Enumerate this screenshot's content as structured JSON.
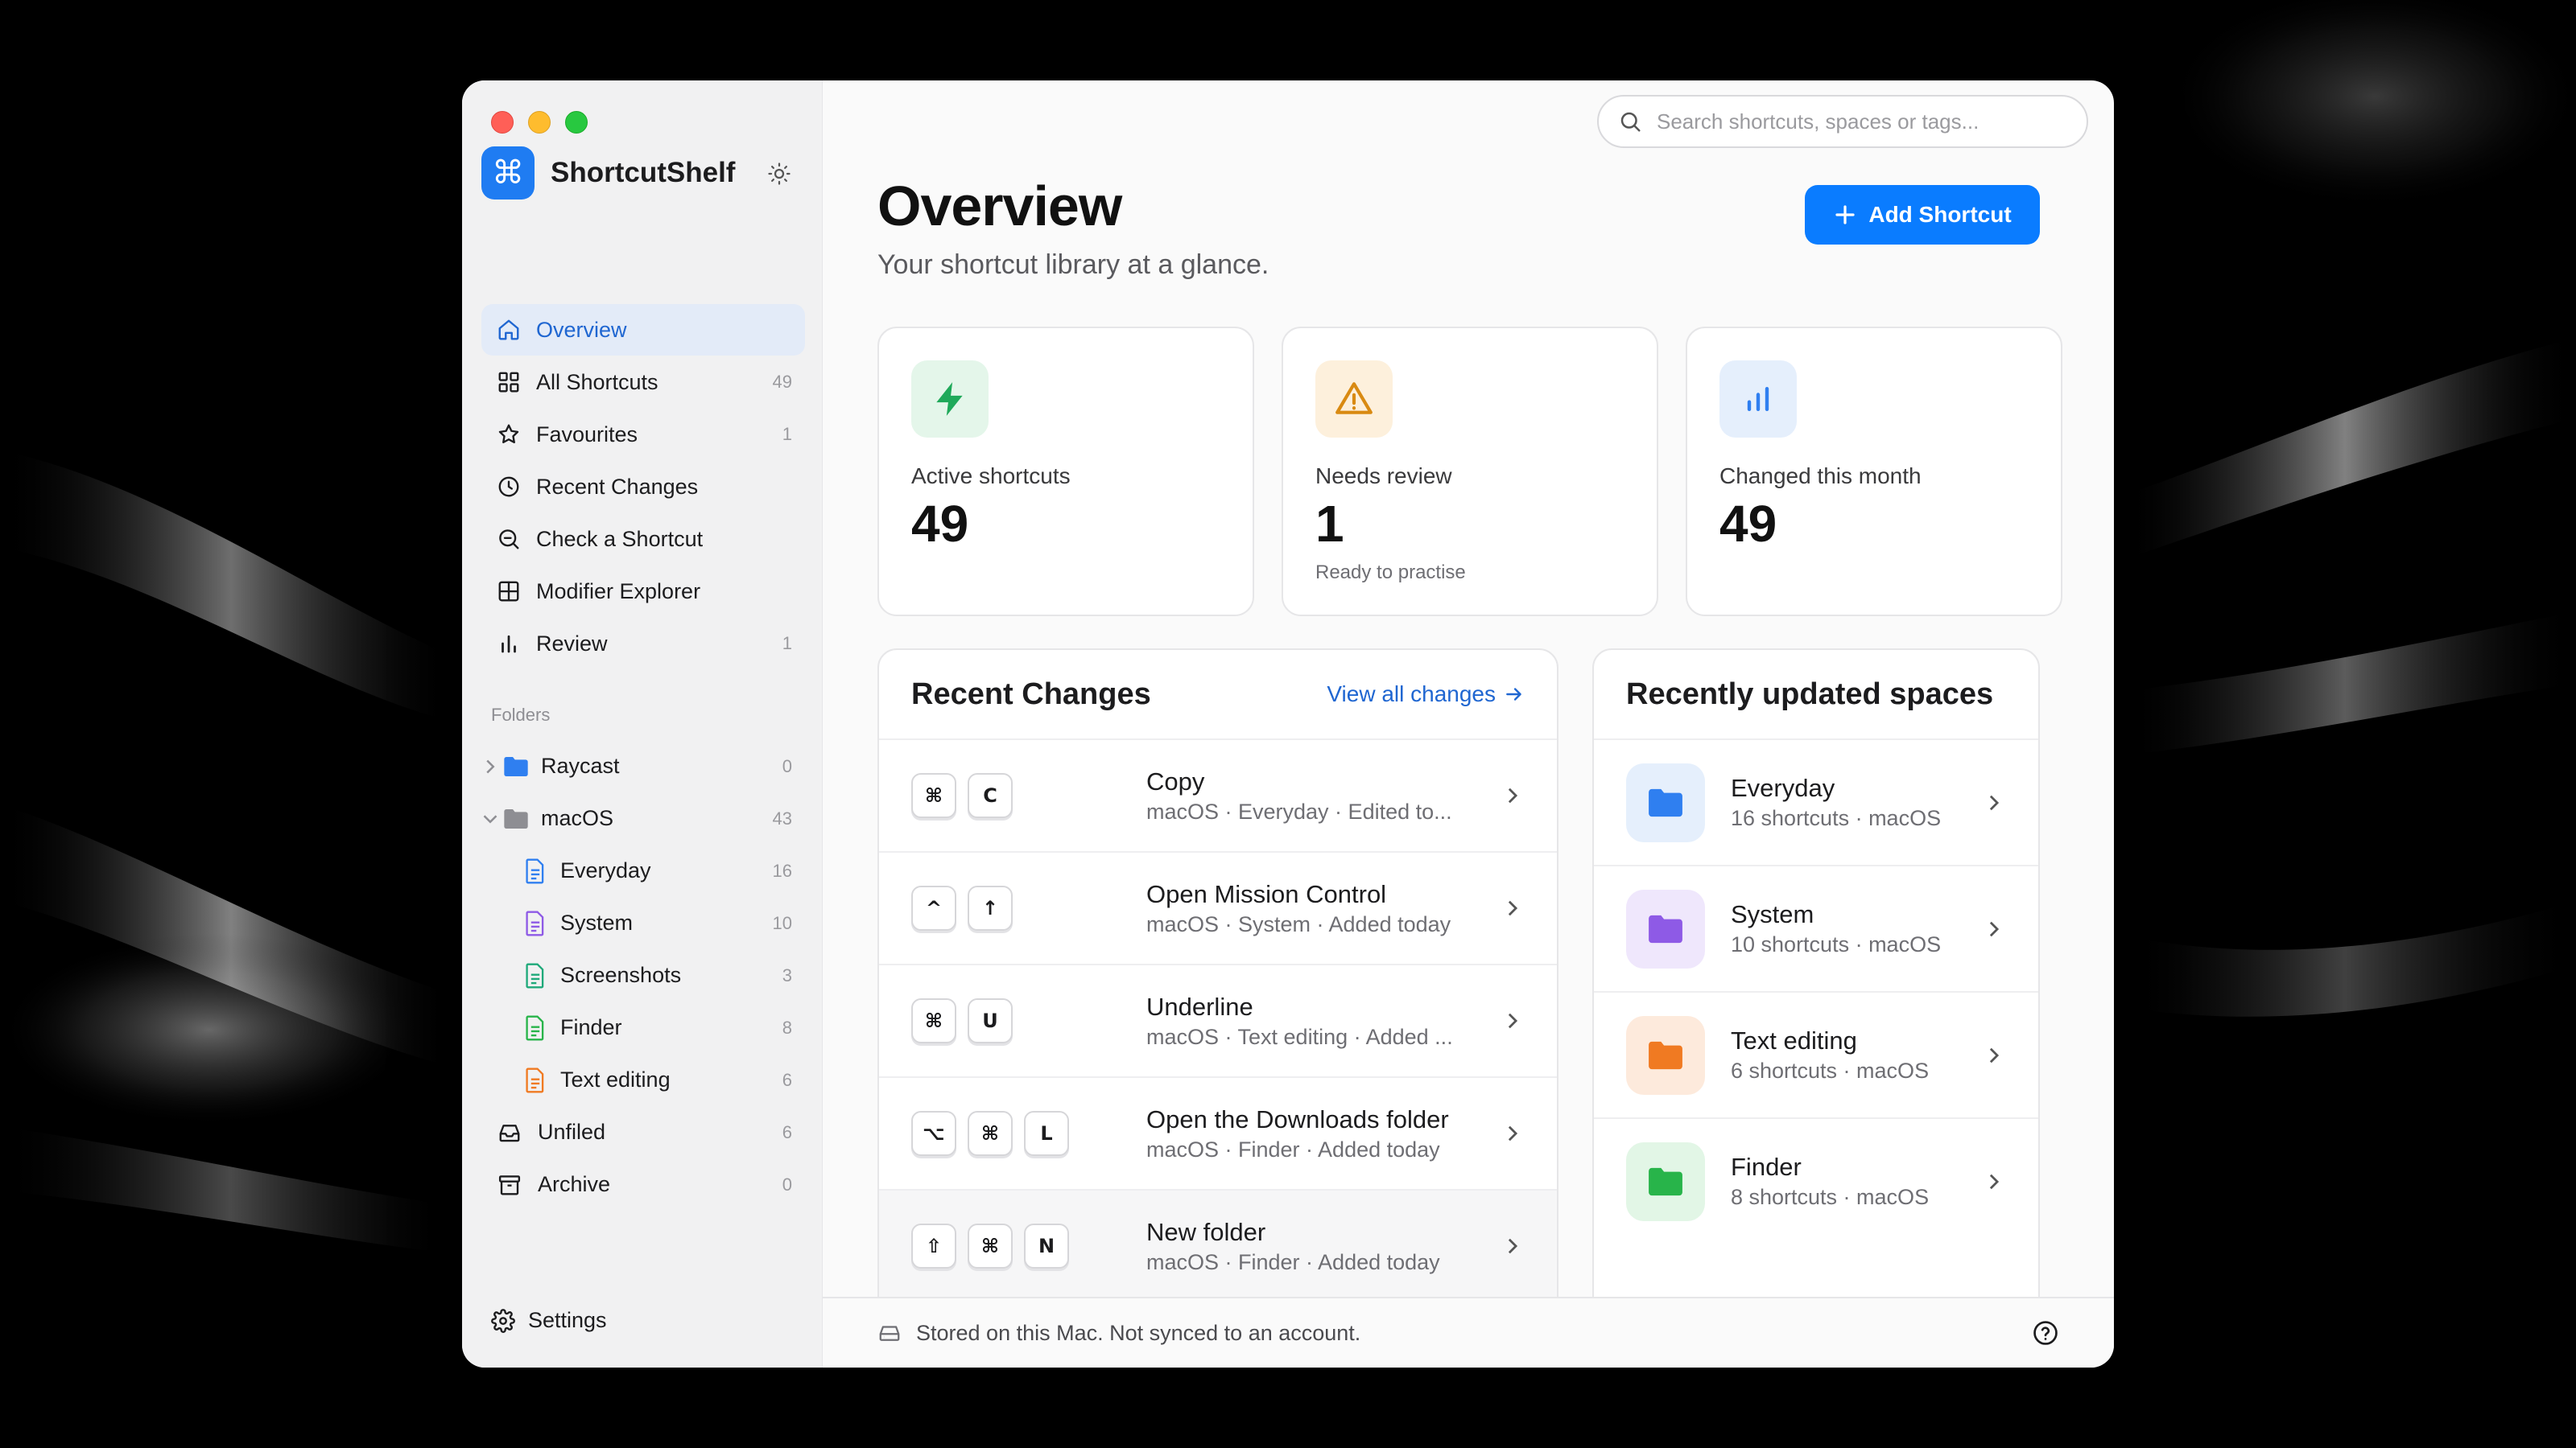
{
  "app": {
    "name": "ShortcutShelf",
    "logo_glyph": "⌘",
    "accent_color": "#0a7cff"
  },
  "sidebar": {
    "nav": [
      {
        "label": "Overview",
        "count": "",
        "icon": "home-icon",
        "active": true
      },
      {
        "label": "All Shortcuts",
        "count": "49",
        "icon": "grid-icon"
      },
      {
        "label": "Favourites",
        "count": "1",
        "icon": "star-icon"
      },
      {
        "label": "Recent Changes",
        "count": "",
        "icon": "clock-icon"
      },
      {
        "label": "Check a Shortcut",
        "count": "",
        "icon": "magnifier-icon"
      },
      {
        "label": "Modifier Explorer",
        "count": "",
        "icon": "command-square-icon"
      },
      {
        "label": "Review",
        "count": "1",
        "icon": "bar-chart-icon"
      }
    ],
    "folders_heading": "Folders",
    "folders": [
      {
        "label": "Raycast",
        "count": "0",
        "icon": "folder-icon",
        "color": "#2f7ff0",
        "expanded": false
      },
      {
        "label": "macOS",
        "count": "43",
        "icon": "folder-icon",
        "color": "#8e8e93",
        "expanded": true
      },
      {
        "label": "Everyday",
        "count": "16",
        "icon": "document-icon",
        "color": "#2f7ff0"
      },
      {
        "label": "System",
        "count": "10",
        "icon": "document-icon",
        "color": "#8e5ae6"
      },
      {
        "label": "Screenshots",
        "count": "3",
        "icon": "document-icon",
        "color": "#1fa97a"
      },
      {
        "label": "Finder",
        "count": "8",
        "icon": "document-icon",
        "color": "#28b44a"
      },
      {
        "label": "Text editing",
        "count": "6",
        "icon": "document-icon",
        "color": "#f07a22"
      },
      {
        "label": "Unfiled",
        "count": "6",
        "icon": "inbox-icon"
      },
      {
        "label": "Archive",
        "count": "0",
        "icon": "archive-icon"
      }
    ],
    "settings_label": "Settings"
  },
  "header": {
    "search_placeholder": "Search shortcuts, spaces or tags...",
    "title": "Overview",
    "subtitle": "Your shortcut library at a glance.",
    "add_button": "Add Shortcut"
  },
  "stats": [
    {
      "label": "Active shortcuts",
      "value": "49",
      "note": "",
      "icon": "bolt-icon",
      "color": "#1fa95a",
      "bg": "#e4f6ea"
    },
    {
      "label": "Needs review",
      "value": "1",
      "note": "Ready to practise",
      "icon": "warning-icon",
      "color": "#d98a12",
      "bg": "#fdf0dc"
    },
    {
      "label": "Changed this month",
      "value": "49",
      "note": "",
      "icon": "bar-chart-icon",
      "color": "#2f7ff0",
      "bg": "#e5effc"
    }
  ],
  "recent_changes": {
    "heading": "Recent Changes",
    "view_all": "View all changes",
    "rows": [
      {
        "keys": [
          "⌘",
          "C"
        ],
        "title": "Copy",
        "meta": "macOS · Everyday · Edited to..."
      },
      {
        "keys": [
          "^",
          "↑"
        ],
        "title": "Open Mission Control",
        "meta": "macOS · System · Added today"
      },
      {
        "keys": [
          "⌘",
          "U"
        ],
        "title": "Underline",
        "meta": "macOS · Text editing · Added ..."
      },
      {
        "keys": [
          "⌥",
          "⌘",
          "L"
        ],
        "title": "Open the Downloads folder",
        "meta": "macOS · Finder · Added today"
      },
      {
        "keys": [
          "⇧",
          "⌘",
          "N"
        ],
        "title": "New folder",
        "meta": "macOS · Finder · Added today"
      }
    ]
  },
  "spaces": {
    "heading": "Recently updated spaces",
    "rows": [
      {
        "title": "Everyday",
        "meta": "16 shortcuts · macOS",
        "color": "#2f7ff0",
        "bg": "#e5effc"
      },
      {
        "title": "System",
        "meta": "10 shortcuts · macOS",
        "color": "#8e5ae6",
        "bg": "#efe7fc"
      },
      {
        "title": "Text editing",
        "meta": "6 shortcuts · macOS",
        "color": "#f07a22",
        "bg": "#fdeadc"
      },
      {
        "title": "Finder",
        "meta": "8 shortcuts · macOS",
        "color": "#28b44a",
        "bg": "#e2f6e6"
      }
    ]
  },
  "footer": {
    "storage_text": "Stored on this Mac. Not synced to an account."
  }
}
